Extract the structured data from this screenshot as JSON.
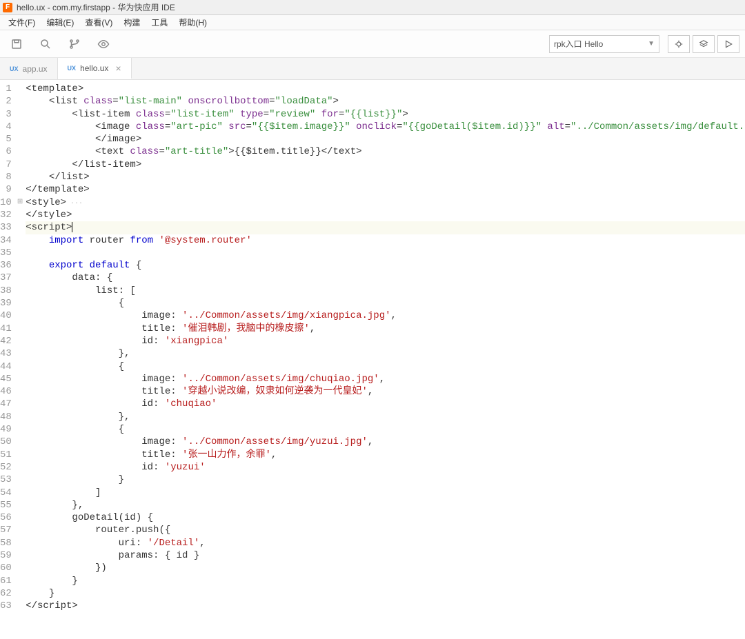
{
  "window": {
    "title": "hello.ux - com.my.firstapp - 华为快应用 IDE"
  },
  "menu": {
    "file": "文件(F)",
    "edit": "编辑(E)",
    "view": "查看(V)",
    "build": "构建",
    "tools": "工具",
    "help": "帮助(H)"
  },
  "toolbar": {
    "run_config": "rpk入口 Hello"
  },
  "tabs": [
    {
      "badge": "UX",
      "label": "app.ux",
      "active": false
    },
    {
      "badge": "UX",
      "label": "hello.ux",
      "active": true
    }
  ],
  "gutter": {
    "lines": [
      "1",
      "2",
      "3",
      "4",
      "5",
      "6",
      "7",
      "8",
      "9",
      "10",
      "32",
      "33",
      "34",
      "35",
      "36",
      "37",
      "38",
      "39",
      "40",
      "41",
      "42",
      "43",
      "44",
      "45",
      "46",
      "47",
      "48",
      "49",
      "50",
      "51",
      "52",
      "53",
      "54",
      "55",
      "56",
      "57",
      "58",
      "59",
      "60",
      "61",
      "62",
      "63"
    ],
    "fold_at_index": 9
  },
  "code": {
    "l1": {
      "i": 0,
      "p": [
        "tag:<template>"
      ]
    },
    "l2": {
      "i": 2,
      "p": [
        "tag:<list ",
        "attr:class",
        "tag:=",
        "str:\"list-main\"",
        "tag: ",
        "attr:onscrollbottom",
        "tag:=",
        "str:\"loadData\"",
        "tag:>"
      ]
    },
    "l3": {
      "i": 4,
      "p": [
        "tag:<list-item ",
        "attr:class",
        "tag:=",
        "str:\"list-item\"",
        "tag: ",
        "attr:type",
        "tag:=",
        "str:\"review\"",
        "tag: ",
        "attr:for",
        "tag:=",
        "str:\"{{list}}\"",
        "tag:>"
      ]
    },
    "l4": {
      "i": 6,
      "p": [
        "tag:<image ",
        "attr:class",
        "tag:=",
        "str:\"art-pic\"",
        "tag: ",
        "attr:src",
        "tag:=",
        "str:\"{{$item.image}}\"",
        "tag: ",
        "attr:onclick",
        "tag:=",
        "str:\"{{goDetail($item.id)}}\"",
        "tag: ",
        "attr:alt",
        "tag:=",
        "str:\"../Common/assets/img/default.png\"",
        "tag:>"
      ]
    },
    "l5": {
      "i": 6,
      "p": [
        "tag:</image>"
      ]
    },
    "l6": {
      "i": 6,
      "p": [
        "tag:<text ",
        "attr:class",
        "tag:=",
        "str:\"art-title\"",
        "tag:>{{$item.title}}</text>"
      ]
    },
    "l7": {
      "i": 4,
      "p": [
        "tag:</list-item>"
      ]
    },
    "l8": {
      "i": 2,
      "p": [
        "tag:</list>"
      ]
    },
    "l9": {
      "i": 0,
      "p": [
        "tag:</template>"
      ]
    },
    "l10": {
      "i": 0,
      "p": [
        "tag:<style>",
        "dots: ···"
      ]
    },
    "l32": {
      "i": 0,
      "p": [
        "tag:</style>"
      ]
    },
    "l33": {
      "i": 0,
      "p": [
        "tag:<script>"
      ],
      "cursor": true
    },
    "l34": {
      "i": 2,
      "p": [
        "kw:import",
        "txt: router ",
        "kw:from",
        "txt: ",
        "jsstr:'@system.router'"
      ]
    },
    "l35": {
      "i": 0,
      "p": [
        "txt:"
      ]
    },
    "l36": {
      "i": 2,
      "p": [
        "kw:export",
        "txt: ",
        "kw:default",
        "txt: {"
      ]
    },
    "l37": {
      "i": 4,
      "p": [
        "txt:data: {"
      ]
    },
    "l38": {
      "i": 6,
      "p": [
        "txt:list: ["
      ]
    },
    "l39": {
      "i": 8,
      "p": [
        "txt:{"
      ]
    },
    "l40": {
      "i": 10,
      "p": [
        "txt:image: ",
        "jsstr:'../Common/assets/img/xiangpica.jpg'",
        "txt:,"
      ]
    },
    "l41": {
      "i": 10,
      "p": [
        "txt:title: ",
        "jsstr:'催泪韩剧，我脑中的橡皮擦'",
        "txt:,"
      ]
    },
    "l42": {
      "i": 10,
      "p": [
        "txt:id: ",
        "jsstr:'xiangpica'"
      ]
    },
    "l43": {
      "i": 8,
      "p": [
        "txt:},"
      ]
    },
    "l44": {
      "i": 8,
      "p": [
        "txt:{"
      ]
    },
    "l45": {
      "i": 10,
      "p": [
        "txt:image: ",
        "jsstr:'../Common/assets/img/chuqiao.jpg'",
        "txt:,"
      ]
    },
    "l46": {
      "i": 10,
      "p": [
        "txt:title: ",
        "jsstr:'穿越小说改编，奴隶如何逆袭为一代皇妃'",
        "txt:,"
      ]
    },
    "l47": {
      "i": 10,
      "p": [
        "txt:id: ",
        "jsstr:'chuqiao'"
      ]
    },
    "l48": {
      "i": 8,
      "p": [
        "txt:},"
      ]
    },
    "l49": {
      "i": 8,
      "p": [
        "txt:{"
      ]
    },
    "l50": {
      "i": 10,
      "p": [
        "txt:image: ",
        "jsstr:'../Common/assets/img/yuzui.jpg'",
        "txt:,"
      ]
    },
    "l51": {
      "i": 10,
      "p": [
        "txt:title: ",
        "jsstr:'张一山力作，余罪'",
        "txt:,"
      ]
    },
    "l52": {
      "i": 10,
      "p": [
        "txt:id: ",
        "jsstr:'yuzui'"
      ]
    },
    "l53": {
      "i": 8,
      "p": [
        "txt:}"
      ]
    },
    "l54": {
      "i": 6,
      "p": [
        "txt:]"
      ]
    },
    "l55": {
      "i": 4,
      "p": [
        "txt:},"
      ]
    },
    "l56": {
      "i": 4,
      "p": [
        "txt:goDetail(id) {"
      ]
    },
    "l57": {
      "i": 6,
      "p": [
        "txt:router.push({"
      ]
    },
    "l58": {
      "i": 8,
      "p": [
        "txt:uri: ",
        "jsstr:'/Detail'",
        "txt:,"
      ]
    },
    "l59": {
      "i": 8,
      "p": [
        "txt:params: { id }"
      ]
    },
    "l60": {
      "i": 6,
      "p": [
        "txt:})"
      ]
    },
    "l61": {
      "i": 4,
      "p": [
        "txt:}"
      ]
    },
    "l62": {
      "i": 2,
      "p": [
        "txt:}"
      ]
    },
    "l63": {
      "i": 0,
      "p": [
        "tag:</script>"
      ]
    }
  }
}
